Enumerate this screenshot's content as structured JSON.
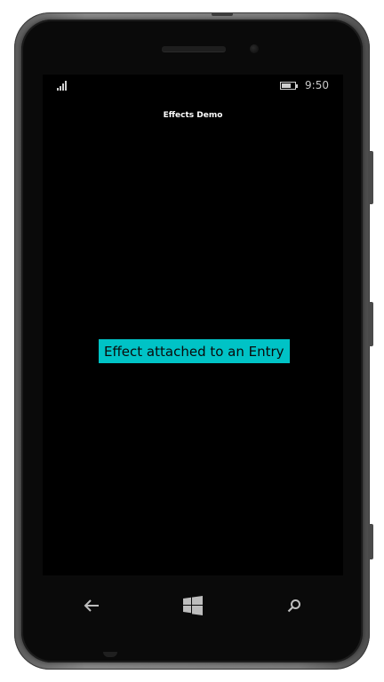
{
  "status_bar": {
    "time": "9:50",
    "signal_icon": "signal-icon",
    "battery_icon": "battery-icon"
  },
  "app": {
    "title": "Effects Demo"
  },
  "entry": {
    "text": "Effect attached to an Entry",
    "background_color": "#00c3c6"
  },
  "nav": {
    "back_icon": "back-arrow-icon",
    "home_icon": "windows-logo-icon",
    "search_icon": "search-icon"
  }
}
